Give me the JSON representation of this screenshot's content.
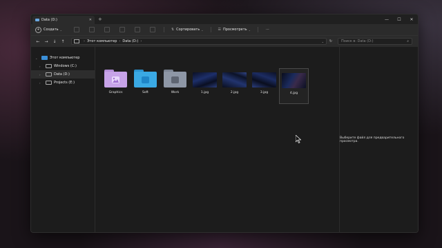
{
  "window": {
    "tab_title": "Data (D:)",
    "tab_close": "✕",
    "new_tab": "+"
  },
  "controls": {
    "minimize": "—",
    "maximize": "☐",
    "close": "✕"
  },
  "toolbar": {
    "new_label": "Создать",
    "sort_label": "Сортировать",
    "view_label": "Просмотреть",
    "more": "···"
  },
  "nav": {
    "back": "←",
    "forward": "→",
    "down": "↓",
    "up": "↑",
    "refresh": "↻"
  },
  "address": {
    "crumbs": [
      "Этот компьютер",
      "Data (D:)"
    ],
    "sep": "›"
  },
  "search": {
    "placeholder": "Поиск в: Data (D:)"
  },
  "sidebar": {
    "items": [
      {
        "label": "Этот компьютер",
        "chev": "⌄",
        "icon": "pc-icon"
      },
      {
        "label": "Windows (C:)",
        "chev": "›",
        "icon": "drive-icon"
      },
      {
        "label": "Data (D:)",
        "chev": "›",
        "icon": "drive-icon",
        "selected": true
      },
      {
        "label": "Projects (E:)",
        "chev": "›",
        "icon": "drive-icon"
      }
    ]
  },
  "items": [
    {
      "name": "Graphics",
      "kind": "folder",
      "color": "#c7a3e8",
      "glyph_color": "#e7d6fa",
      "icon": "image-icon"
    },
    {
      "name": "Soft",
      "kind": "folder",
      "color": "#3aa9e4",
      "glyph_color": "#1f86c8",
      "icon": "cube-icon"
    },
    {
      "name": "Work",
      "kind": "folder",
      "color": "#8e97a6",
      "glyph_color": "#5e6572",
      "icon": "document-icon"
    },
    {
      "name": "1.jpg",
      "kind": "image"
    },
    {
      "name": "2.jpg",
      "kind": "image"
    },
    {
      "name": "3.jpg",
      "kind": "image"
    },
    {
      "name": "4.jpg",
      "kind": "image",
      "selected": true
    }
  ],
  "preview": {
    "message": "Выберите файл для предварительного просмотра."
  }
}
